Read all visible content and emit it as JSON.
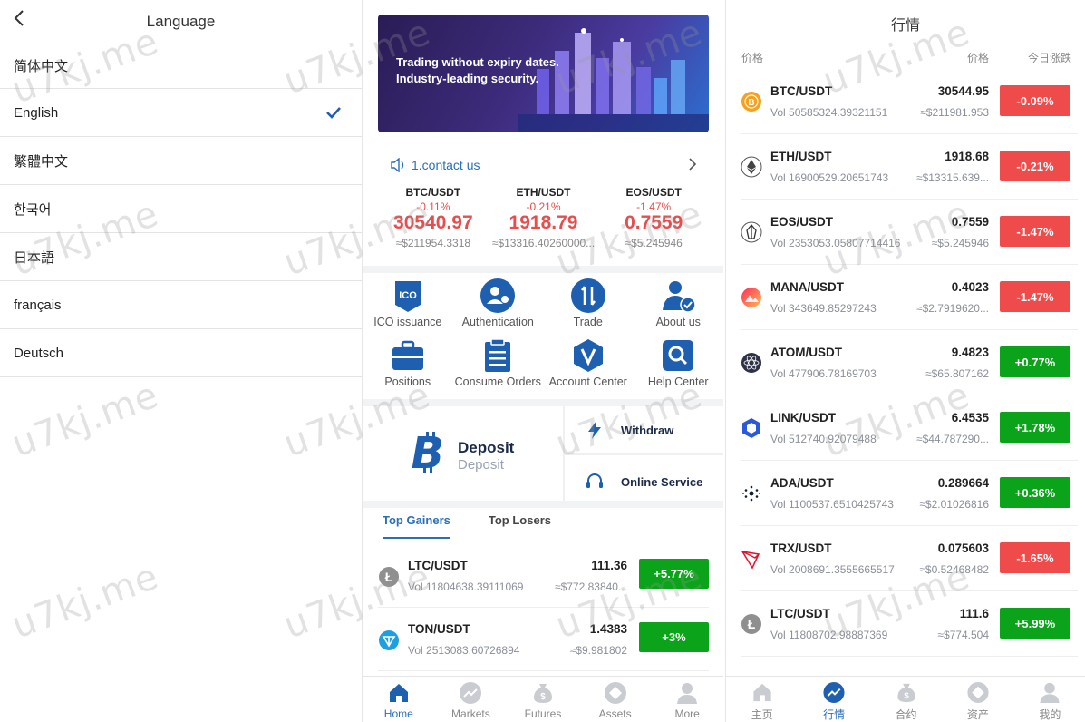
{
  "language_panel": {
    "title": "Language",
    "items": [
      {
        "label": "简体中文",
        "selected": false
      },
      {
        "label": "English",
        "selected": true
      },
      {
        "label": "繁體中文",
        "selected": false
      },
      {
        "label": "한국어",
        "selected": false
      },
      {
        "label": "日本語",
        "selected": false
      },
      {
        "label": "français",
        "selected": false
      },
      {
        "label": "Deutsch",
        "selected": false
      }
    ]
  },
  "home": {
    "banner": {
      "line1": "Trading without expiry dates.",
      "line2": "Industry-leading security."
    },
    "notice": "1.contact us",
    "tickers": [
      {
        "pair": "BTC/USDT",
        "change": "-0.11%",
        "price": "30540.97",
        "cny": "≈$211954.3318"
      },
      {
        "pair": "ETH/USDT",
        "change": "-0.21%",
        "price": "1918.79",
        "cny": "≈$13316.40260000..."
      },
      {
        "pair": "EOS/USDT",
        "change": "-1.47%",
        "price": "0.7559",
        "cny": "≈$5.245946"
      }
    ],
    "grid": [
      {
        "label": "ICO issuance",
        "icon": "ico-icon"
      },
      {
        "label": "Authentication",
        "icon": "user-auth-icon"
      },
      {
        "label": "Trade",
        "icon": "trade-icon"
      },
      {
        "label": "About us",
        "icon": "about-user-check-icon"
      },
      {
        "label": "Positions",
        "icon": "briefcase-icon"
      },
      {
        "label": "Consume Orders",
        "icon": "clipboard-icon"
      },
      {
        "label": "Account Center",
        "icon": "v-shield-icon"
      },
      {
        "label": "Help Center",
        "icon": "search-icon"
      }
    ],
    "deposit": {
      "title": "Deposit",
      "subtitle": "Deposit"
    },
    "withdraw": "Withdraw",
    "online_service": "Online Service",
    "tabs": [
      "Top Gainers",
      "Top Losers"
    ],
    "rows": [
      {
        "pair": "LTC/USDT",
        "vol": "Vol 11804638.39111069",
        "price": "111.36",
        "cny": "≈$772.83840...",
        "change": "+5.77%",
        "dir": "up"
      },
      {
        "pair": "TON/USDT",
        "vol": "Vol 2513083.60726894",
        "price": "1.4383",
        "cny": "≈$9.981802",
        "change": "+3%",
        "dir": "up"
      }
    ],
    "nav": [
      {
        "label": "Home",
        "icon": "home-icon",
        "active": true
      },
      {
        "label": "Markets",
        "icon": "markets-icon",
        "active": false
      },
      {
        "label": "Futures",
        "icon": "futures-icon",
        "active": false
      },
      {
        "label": "Assets",
        "icon": "assets-icon",
        "active": false
      },
      {
        "label": "More",
        "icon": "user-icon",
        "active": false
      }
    ]
  },
  "markets": {
    "title": "行情",
    "col_left": "价格",
    "col_mid": "价格",
    "col_right": "今日涨跌",
    "rows": [
      {
        "pair": "BTC/USDT",
        "vol": "Vol 50585324.39321151",
        "price": "30544.95",
        "cny": "≈$211981.953",
        "change": "-0.09%",
        "dir": "down",
        "coin": "btc"
      },
      {
        "pair": "ETH/USDT",
        "vol": "Vol 16900529.20651743",
        "price": "1918.68",
        "cny": "≈$13315.639...",
        "change": "-0.21%",
        "dir": "down",
        "coin": "eth"
      },
      {
        "pair": "EOS/USDT",
        "vol": "Vol 2353053.05807714416",
        "price": "0.7559",
        "cny": "≈$5.245946",
        "change": "-1.47%",
        "dir": "down",
        "coin": "eos"
      },
      {
        "pair": "MANA/USDT",
        "vol": "Vol 343649.85297243",
        "price": "0.4023",
        "cny": "≈$2.7919620...",
        "change": "-1.47%",
        "dir": "down",
        "coin": "mana"
      },
      {
        "pair": "ATOM/USDT",
        "vol": "Vol 477906.78169703",
        "price": "9.4823",
        "cny": "≈$65.807162",
        "change": "+0.77%",
        "dir": "up",
        "coin": "atom"
      },
      {
        "pair": "LINK/USDT",
        "vol": "Vol 512740.92079488",
        "price": "6.4535",
        "cny": "≈$44.787290...",
        "change": "+1.78%",
        "dir": "up",
        "coin": "link"
      },
      {
        "pair": "ADA/USDT",
        "vol": "Vol 1100537.6510425743",
        "price": "0.289664",
        "cny": "≈$2.01026816",
        "change": "+0.36%",
        "dir": "up",
        "coin": "ada"
      },
      {
        "pair": "TRX/USDT",
        "vol": "Vol 2008691.3555665517",
        "price": "0.075603",
        "cny": "≈$0.52468482",
        "change": "-1.65%",
        "dir": "down",
        "coin": "trx"
      },
      {
        "pair": "LTC/USDT",
        "vol": "Vol 11808702.98887369",
        "price": "111.6",
        "cny": "≈$774.504",
        "change": "+5.99%",
        "dir": "up",
        "coin": "ltc"
      }
    ],
    "nav": [
      {
        "label": "主页",
        "icon": "home-icon",
        "active": false
      },
      {
        "label": "行情",
        "icon": "markets-icon",
        "active": true
      },
      {
        "label": "合约",
        "icon": "futures-icon",
        "active": false
      },
      {
        "label": "资产",
        "icon": "assets-icon",
        "active": false
      },
      {
        "label": "我的",
        "icon": "user-icon",
        "active": false
      }
    ]
  },
  "watermark": "u7kj.me",
  "colors": {
    "up": "#0aa31a",
    "down": "#f04b4b",
    "accent": "#2a6fb8",
    "nav_blue": "#1e5fb0"
  }
}
